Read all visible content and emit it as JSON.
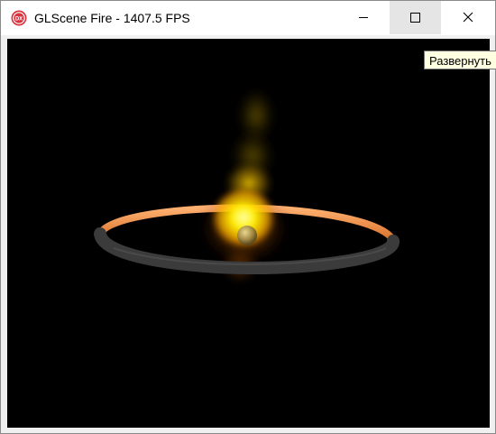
{
  "window": {
    "title": "GLScene Fire - 1407.5 FPS",
    "icon": "dx-app-icon"
  },
  "caption_buttons": {
    "minimize": "minimize-icon",
    "maximize": "maximize-icon",
    "close": "close-icon"
  },
  "tooltip": {
    "text": "Развернуть"
  },
  "colors": {
    "viewport_background": "#000000",
    "flame_core": "#ffe600",
    "flame_glow": "#ff8a00",
    "ring_top": "#f08a3a",
    "ring_bottom": "#3a3a3a"
  }
}
